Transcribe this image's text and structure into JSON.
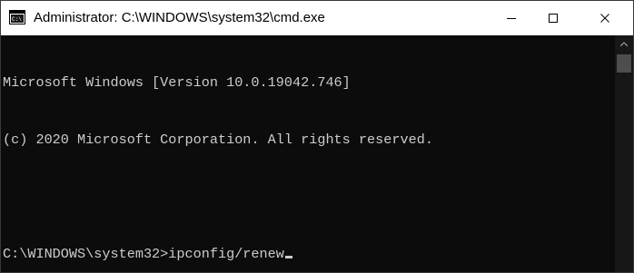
{
  "window": {
    "title": "Administrator: C:\\WINDOWS\\system32\\cmd.exe",
    "icon": "cmd-icon",
    "controls": {
      "minimize": "minimize-icon",
      "maximize": "maximize-icon",
      "close": "close-icon"
    }
  },
  "console": {
    "lines": [
      "Microsoft Windows [Version 10.0.19042.746]",
      "(c) 2020 Microsoft Corporation. All rights reserved.",
      "",
      "C:\\WINDOWS\\system32>ipconfig/renew"
    ]
  },
  "colors": {
    "background": "#0c0c0c",
    "text": "#cccccc",
    "titlebar": "#ffffff"
  }
}
